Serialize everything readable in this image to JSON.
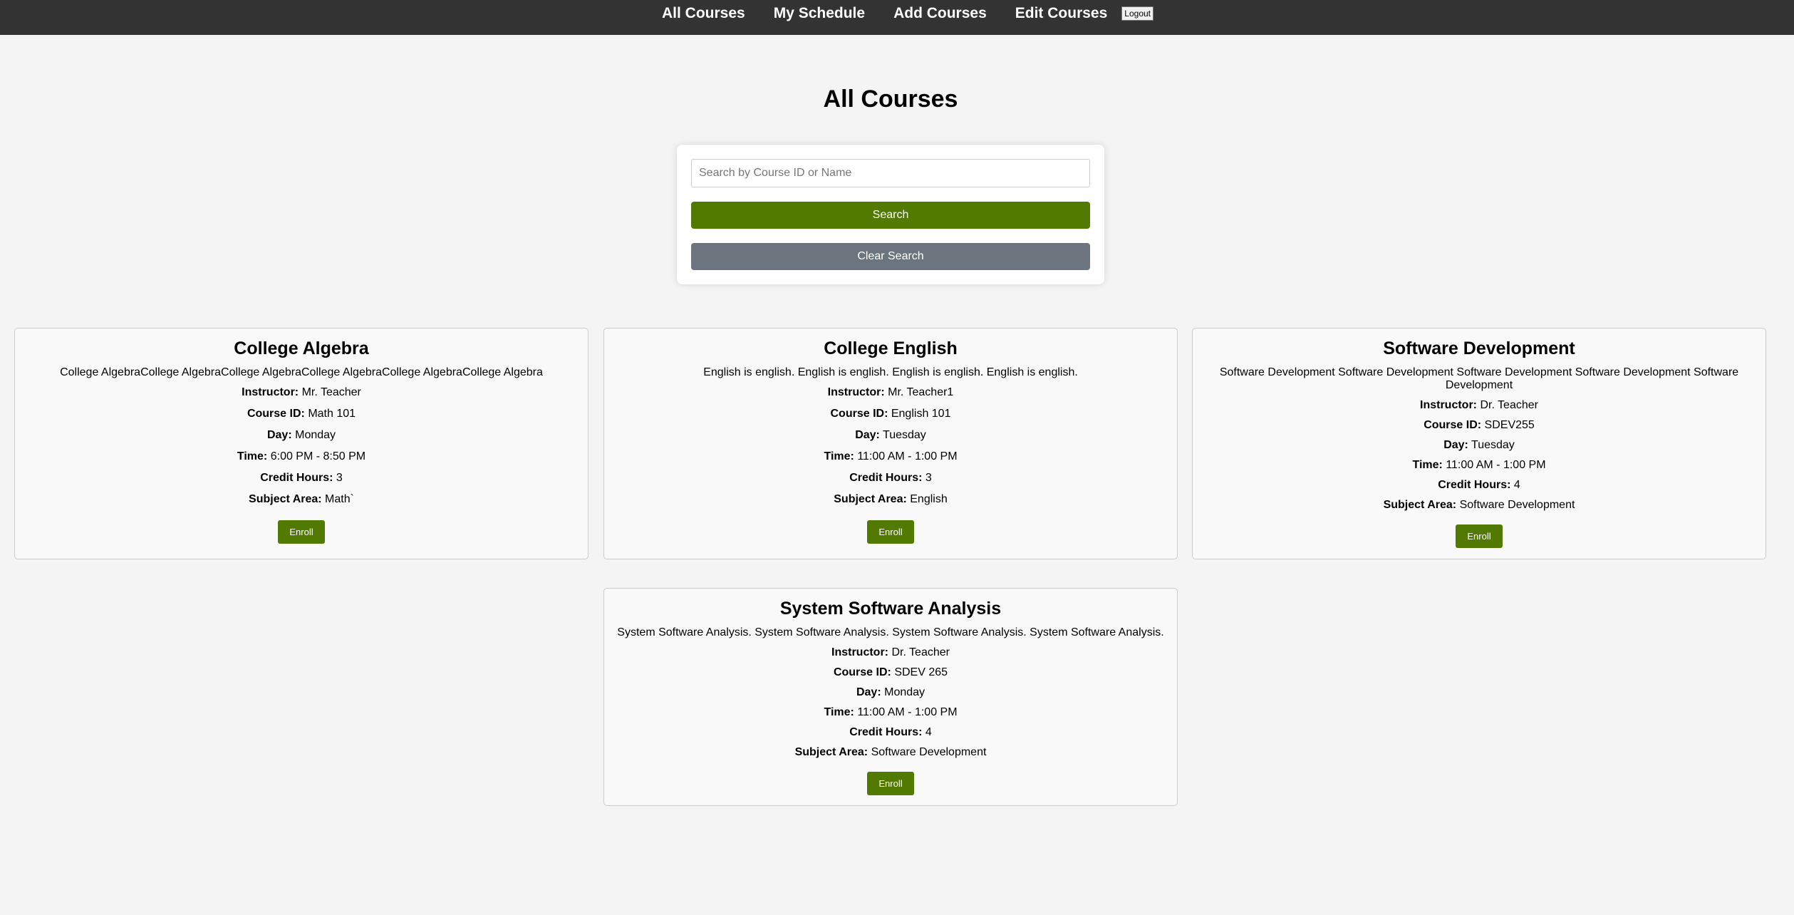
{
  "nav": {
    "links": [
      "All Courses",
      "My Schedule",
      "Add Courses",
      "Edit Courses"
    ],
    "logout_label": "Logout"
  },
  "page": {
    "title": "All Courses"
  },
  "search": {
    "placeholder": "Search by Course ID or Name",
    "value": "",
    "search_label": "Search",
    "clear_label": "Clear Search"
  },
  "labels": {
    "instructor": "Instructor:",
    "course_id": "Course ID:",
    "day": "Day:",
    "time": "Time:",
    "credit_hours": "Credit Hours:",
    "subject_area": "Subject Area:",
    "enroll": "Enroll"
  },
  "courses": [
    {
      "title": "College Algebra",
      "description": "College AlgebraCollege AlgebraCollege AlgebraCollege AlgebraCollege AlgebraCollege Algebra",
      "instructor": "Mr. Teacher",
      "course_id": "Math 101",
      "day": "Monday",
      "time": "6:00 PM - 8:50 PM",
      "credit_hours": "3",
      "subject_area": "Math`"
    },
    {
      "title": "College English",
      "description": "English is english. English is english. English is english. English is english.",
      "instructor": "Mr. Teacher1",
      "course_id": "English 101",
      "day": "Tuesday",
      "time": "11:00 AM - 1:00 PM",
      "credit_hours": "3",
      "subject_area": "English"
    },
    {
      "title": "Software Development",
      "description": "Software Development Software Development Software Development Software Development Software Development",
      "instructor": "Dr. Teacher",
      "course_id": "SDEV255",
      "day": "Tuesday",
      "time": "11:00 AM - 1:00 PM",
      "credit_hours": "4",
      "subject_area": "Software Development"
    },
    {
      "title": "System Software Analysis",
      "description": "System Software Analysis. System Software Analysis. System Software Analysis. System Software Analysis.",
      "instructor": "Dr. Teacher",
      "course_id": "SDEV 265",
      "day": "Monday",
      "time": "11:00 AM - 1:00 PM",
      "credit_hours": "4",
      "subject_area": "Software Development"
    }
  ],
  "colors": {
    "nav_bg": "#333333",
    "accent_green": "#527a00",
    "clear_gray": "#6c757d",
    "page_bg": "#f4f4f4"
  }
}
